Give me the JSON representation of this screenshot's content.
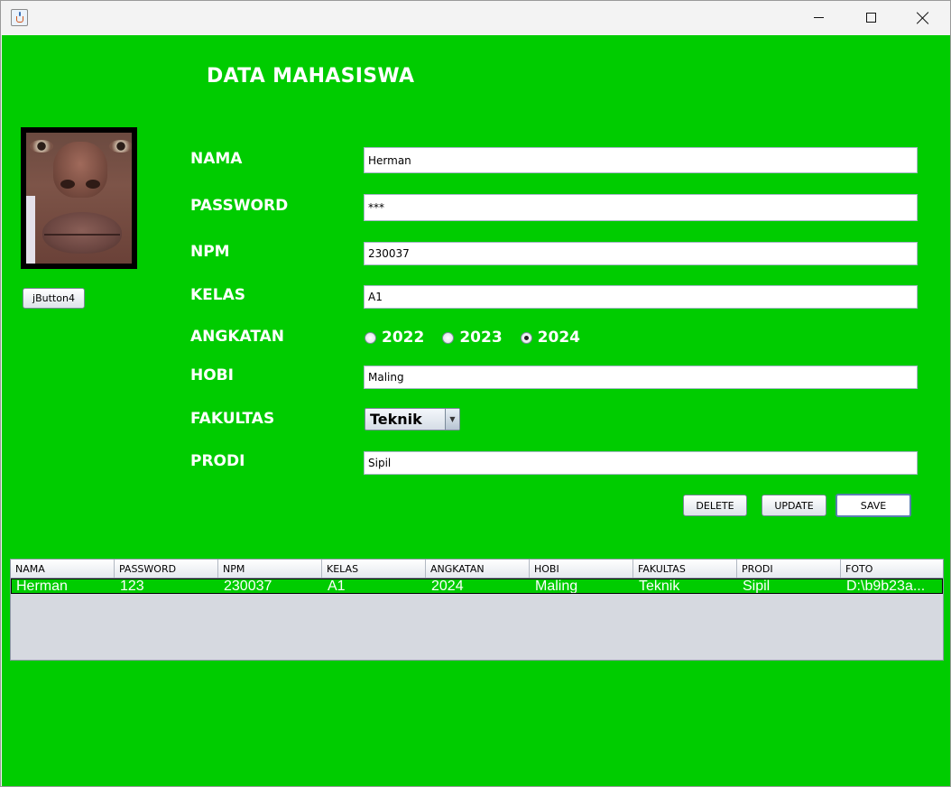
{
  "window": {
    "title": ""
  },
  "heading": "DATA MAHASISWA",
  "photo_button": "jButton4",
  "form": {
    "nama": {
      "label": "NAMA",
      "value": "Herman"
    },
    "password": {
      "label": "PASSWORD",
      "value": "***"
    },
    "npm": {
      "label": "NPM",
      "value": "230037"
    },
    "kelas": {
      "label": "KELAS",
      "value": "A1"
    },
    "angkatan": {
      "label": "ANGKATAN",
      "options": [
        "2022",
        "2023",
        "2024"
      ],
      "selected": "2024"
    },
    "hobi": {
      "label": "HOBI",
      "value": "Maling"
    },
    "fakultas": {
      "label": "FAKULTAS",
      "selected": "Teknik"
    },
    "prodi": {
      "label": "PRODI",
      "value": "Sipil"
    }
  },
  "buttons": {
    "delete": "DELETE",
    "update": "UPDATE",
    "save": "SAVE"
  },
  "table": {
    "columns": [
      "NAMA",
      "PASSWORD",
      "NPM",
      "KELAS",
      "ANGKATAN",
      "HOBI",
      "FAKULTAS",
      "PRODI",
      "FOTO"
    ],
    "rows": [
      [
        "Herman",
        "123",
        "230037",
        "A1",
        "2024",
        "Maling",
        "Teknik",
        "Sipil",
        "D:\\b9b23a..."
      ]
    ]
  },
  "colors": {
    "background": "#00cc00",
    "text": "#ffffff"
  }
}
